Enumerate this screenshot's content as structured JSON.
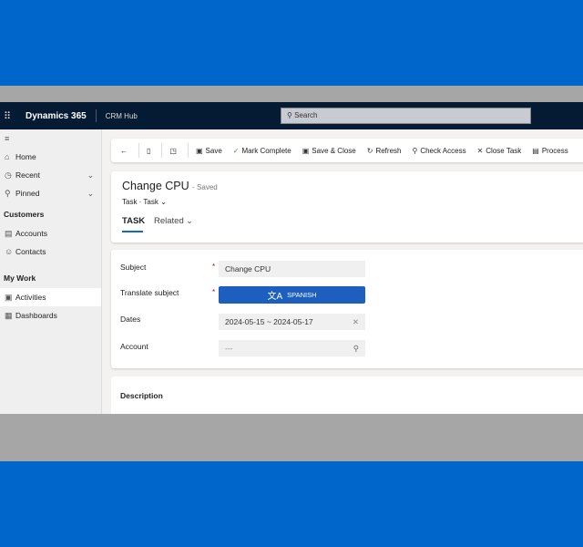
{
  "topbar": {
    "brand": "Dynamics 365",
    "hub": "CRM Hub",
    "search": "Search"
  },
  "sidebar": {
    "home": "Home",
    "recent": "Recent",
    "pinned": "Pinned",
    "customers": "Customers",
    "accounts": "Accounts",
    "contacts": "Contacts",
    "my_work": "My Work",
    "activities": "Activities",
    "dashboards": "Dashboards"
  },
  "commands": {
    "save": "Save",
    "mark_complete": "Mark Complete",
    "save_close": "Save & Close",
    "refresh": "Refresh",
    "check_access": "Check Access",
    "close_task": "Close Task",
    "process": "Process"
  },
  "header": {
    "title": "Change CPU",
    "status": "- Saved",
    "entity": "Task",
    "form": "Task",
    "tabs": [
      "TASK",
      "Related"
    ]
  },
  "form": {
    "subject_label": "Subject",
    "subject_value": "Change CPU",
    "translate_label": "Translate subject",
    "translate_button": "SPANISH",
    "dates_label": "Dates",
    "dates_value": "2024-05-15 ~ 2024-05-17",
    "account_label": "Account",
    "account_value": "---"
  },
  "description": {
    "label": "Description"
  }
}
